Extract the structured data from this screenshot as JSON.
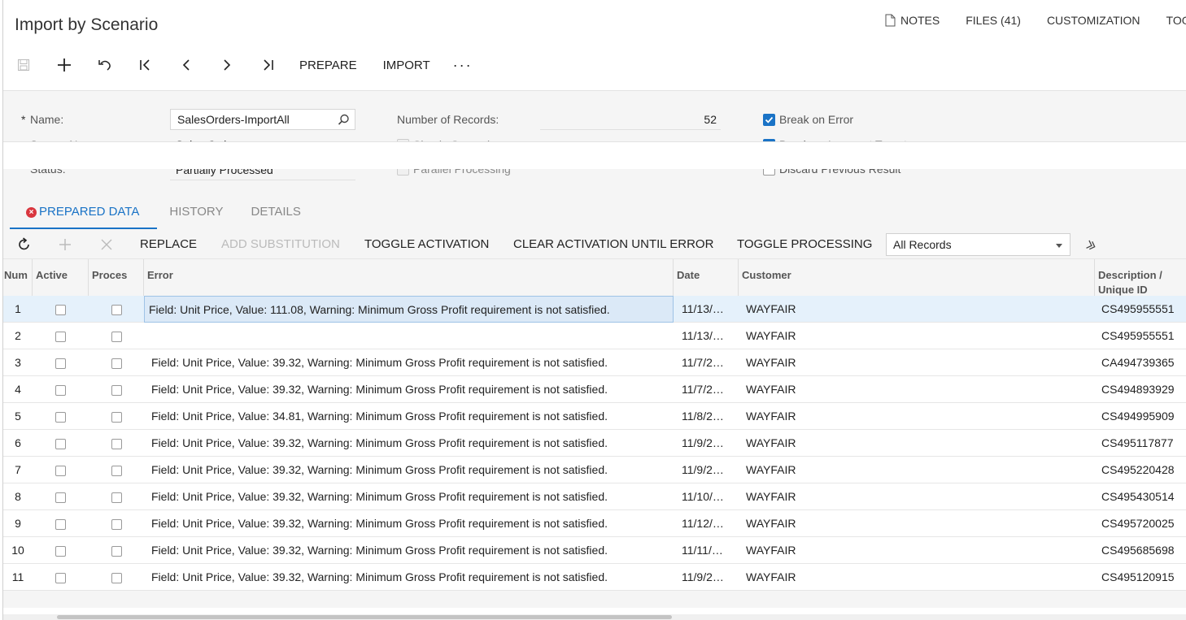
{
  "header": {
    "title": "Import by Scenario",
    "links": [
      "NOTES",
      "FILES (41)",
      "CUSTOMIZATION",
      "TOO"
    ]
  },
  "toolbar": {
    "prepare": "PREPARE",
    "import": "IMPORT",
    "more": "···"
  },
  "form": {
    "name_required": "*",
    "name_label": "Name:",
    "name_value": "SalesOrders-ImportAll",
    "screen_label": "Screen Name:",
    "screen_value": "Sales Orders",
    "status_label": "Status:",
    "status_value": "Partially Processed",
    "num_records_label": "Number of Records:",
    "num_records_value": "52",
    "simple_scenario": {
      "label": "Simple Scenario",
      "checked": false
    },
    "parallel_processing": {
      "label": "Parallel Processing",
      "checked": false
    },
    "break_on_error": {
      "label": "Break on Error",
      "checked": true
    },
    "break_on_incorrect_target": {
      "label": "Break on Incorrect Target",
      "checked": true
    },
    "discard_previous_result": {
      "label": "Discard Previous Result",
      "checked": false
    }
  },
  "tabs": [
    "PREPARED DATA",
    "HISTORY",
    "DETAILS"
  ],
  "grid_toolbar": {
    "replace": "REPLACE",
    "add_substitution": "ADD SUBSTITUTION",
    "toggle_activation": "TOGGLE ACTIVATION",
    "clear_activation": "CLEAR ACTIVATION UNTIL ERROR",
    "toggle_processing": "TOGGLE PROCESSING",
    "filter_value": "All Records"
  },
  "grid": {
    "columns": [
      "Num",
      "Active",
      "Proces",
      "Error",
      "Date",
      "Customer",
      "Description / Unique ID"
    ],
    "rows": [
      {
        "num": "1",
        "error": "Field: Unit Price, Value: 111.08, Warning: Minimum Gross Profit requirement is not satisfied.",
        "date": "11/13/…",
        "customer": "WAYFAIR",
        "desc": "CS495955551"
      },
      {
        "num": "2",
        "error": "",
        "date": "11/13/…",
        "customer": "WAYFAIR",
        "desc": "CS495955551"
      },
      {
        "num": "3",
        "error": "Field: Unit Price, Value: 39.32, Warning: Minimum Gross Profit requirement is not satisfied.",
        "date": "11/7/2…",
        "customer": "WAYFAIR",
        "desc": "CA494739365"
      },
      {
        "num": "4",
        "error": "Field: Unit Price, Value: 39.32, Warning: Minimum Gross Profit requirement is not satisfied.",
        "date": "11/7/2…",
        "customer": "WAYFAIR",
        "desc": "CS494893929"
      },
      {
        "num": "5",
        "error": "Field: Unit Price, Value: 34.81, Warning: Minimum Gross Profit requirement is not satisfied.",
        "date": "11/8/2…",
        "customer": "WAYFAIR",
        "desc": "CS494995909"
      },
      {
        "num": "6",
        "error": "Field: Unit Price, Value: 39.32, Warning: Minimum Gross Profit requirement is not satisfied.",
        "date": "11/9/2…",
        "customer": "WAYFAIR",
        "desc": "CS495117877"
      },
      {
        "num": "7",
        "error": "Field: Unit Price, Value: 39.32, Warning: Minimum Gross Profit requirement is not satisfied.",
        "date": "11/9/2…",
        "customer": "WAYFAIR",
        "desc": "CS495220428"
      },
      {
        "num": "8",
        "error": "Field: Unit Price, Value: 39.32, Warning: Minimum Gross Profit requirement is not satisfied.",
        "date": "11/10/…",
        "customer": "WAYFAIR",
        "desc": "CS495430514"
      },
      {
        "num": "9",
        "error": "Field: Unit Price, Value: 39.32, Warning: Minimum Gross Profit requirement is not satisfied.",
        "date": "11/12/…",
        "customer": "WAYFAIR",
        "desc": "CS495720025"
      },
      {
        "num": "10",
        "error": "Field: Unit Price, Value: 39.32, Warning: Minimum Gross Profit requirement is not satisfied.",
        "date": "11/11/…",
        "customer": "WAYFAIR",
        "desc": "CS495685698"
      },
      {
        "num": "11",
        "error": "Field: Unit Price, Value: 39.32, Warning: Minimum Gross Profit requirement is not satisfied.",
        "date": "11/9/2…",
        "customer": "WAYFAIR",
        "desc": "CS495120915"
      }
    ]
  },
  "colors": {
    "accent": "#1a73c6",
    "error": "#d9363e",
    "selected_row": "#e5f1fb"
  }
}
